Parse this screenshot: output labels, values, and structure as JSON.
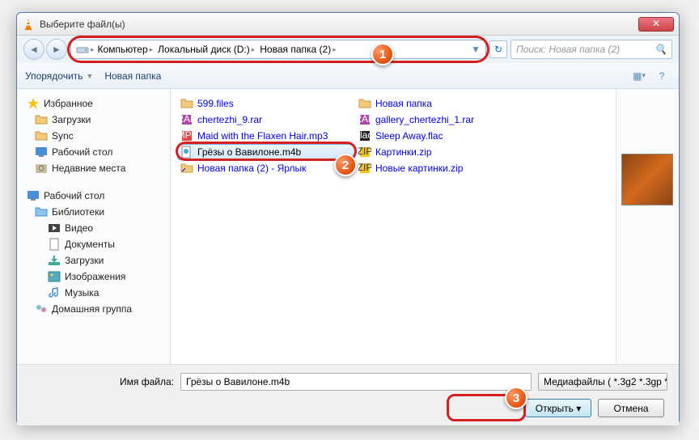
{
  "title": "Выберите файл(ы)",
  "breadcrumb": [
    "Компьютер",
    "Локальный диск (D:)",
    "Новая папка (2)"
  ],
  "search_placeholder": "Поиск: Новая папка (2)",
  "toolbar": {
    "organize": "Упорядочить",
    "newfolder": "Новая папка"
  },
  "sidebar": {
    "favorites": {
      "title": "Избранное",
      "items": [
        "Загрузки",
        "Sync",
        "Рабочий стол",
        "Недавние места"
      ]
    },
    "desktop": {
      "title": "Рабочий стол"
    },
    "libraries": {
      "title": "Библиотеки",
      "items": [
        "Видео",
        "Документы",
        "Загрузки",
        "Изображения",
        "Музыка"
      ]
    },
    "homegroup": {
      "title": "Домашняя группа"
    }
  },
  "files": {
    "col1": [
      {
        "name": "599.files",
        "type": "folder"
      },
      {
        "name": "chertezhi_9.rar",
        "type": "rar"
      },
      {
        "name": "Maid with the Flaxen Hair.mp3",
        "type": "audio"
      },
      {
        "name": "Грёзы о Вавилоне.m4b",
        "type": "audio",
        "selected": true
      },
      {
        "name": "Новая папка (2) - Ярлык",
        "type": "shortcut"
      }
    ],
    "col2": [
      {
        "name": "Новая папка",
        "type": "folder"
      },
      {
        "name": "gallery_chertezhi_1.rar",
        "type": "rar"
      },
      {
        "name": "Sleep Away.flac",
        "type": "flac"
      },
      {
        "name": "Картинки.zip",
        "type": "zip"
      },
      {
        "name": "Новые картинки.zip",
        "type": "zip"
      }
    ]
  },
  "footer": {
    "label": "Имя файла:",
    "value": "Грёзы о Вавилоне.m4b",
    "filter": "Медиафайлы ( *.3g2 *.3gp *.3g",
    "open": "Открыть",
    "cancel": "Отмена"
  },
  "callouts": {
    "c1": "1",
    "c2": "2",
    "c3": "3"
  }
}
